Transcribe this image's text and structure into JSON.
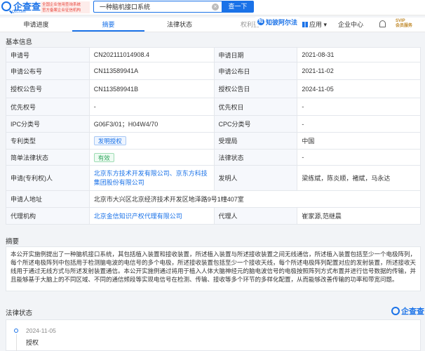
{
  "header": {
    "logo_text": "企查查",
    "logo_sub": "Qcc.com",
    "slogan_line1": "全国企业信用查询系统",
    "slogan_line2": "官方备案企业征信机构",
    "search_value": "一种脑机接口系统",
    "search_button": "查一下"
  },
  "tabs": {
    "items": [
      "申请进度",
      "摘要",
      "法律状态"
    ],
    "active": "摘要",
    "truncated": "权利要",
    "zhidi_label": "知彼阿尔法",
    "apps_label": "应用",
    "enterprise_center": "企业中心",
    "vip_line1": "SVIP",
    "vip_line2": "会员服务"
  },
  "basic": {
    "title": "基本信息",
    "rows": [
      {
        "l1": "申请号",
        "v1": "CN202111014908.4",
        "l2": "申请日期",
        "v2": "2021-08-31"
      },
      {
        "l1": "申请公布号",
        "v1": "CN113589941A",
        "l2": "申请公布日",
        "v2": "2021-11-02"
      },
      {
        "l1": "授权公告号",
        "v1": "CN113589941B",
        "l2": "授权公告日",
        "v2": "2024-11-05"
      },
      {
        "l1": "优先权号",
        "v1": "-",
        "l2": "优先权日",
        "v2": "-"
      },
      {
        "l1": "IPC分类号",
        "v1": "G06F3/01；H04W4/70",
        "l2": "CPC分类号",
        "v2": "-"
      },
      {
        "l1": "专利类型",
        "v1": "发明授权",
        "l2": "受理局",
        "v2": "中国"
      },
      {
        "l1": "简单法律状态",
        "v1": "有效",
        "l2": "法律状态",
        "v2": "-"
      },
      {
        "l1": "申请(专利权)人",
        "v1a": "北京东方技术开发有限公司、",
        "v1b": "京东方科技集团股份有限公司",
        "l2": "发明人",
        "v2": "梁练斌，陈炎顺，褚斌，马永达"
      },
      {
        "l1": "申请人地址",
        "v1": "北京市大兴区北京经济技术开发区地泽路9号1幢407室"
      },
      {
        "l1": "代理机构",
        "v1": "北京金信知识产权代理有限公司",
        "l2": "代理人",
        "v2": "崔家源,范继晨"
      }
    ]
  },
  "abstract": {
    "title": "摘要",
    "text": "本公开实施例提出了一种脑机接口系统，其包括植入装置和接收装置，所述植入装置与所述接收装置之间无线通信，所述植入装置包括至少一个电极阵列，每个所述电极阵列中包括用于检测脑电波的电信号的多个电极，所述接收装置包括至少一个接收天线，每个所述电极阵列配置对应的发射装置，所述接收天线用于通过无线方式与所述发射装置通信。本公开实施例通过将用于植入人体大脑神经元的脑电波信号的电极按照阵列方式布置并进行信号数据的传输，并且能够基于大脑上的不同区域、不同的通信频段等实现电信号在检测、传输、接收等多个环节的多样化配置，从而能够改善传输的功率和带宽问题。"
  },
  "legal": {
    "title": "法律状态",
    "watermark": "企查查",
    "events": [
      {
        "date": "2024-11-05",
        "event": "授权"
      }
    ]
  }
}
